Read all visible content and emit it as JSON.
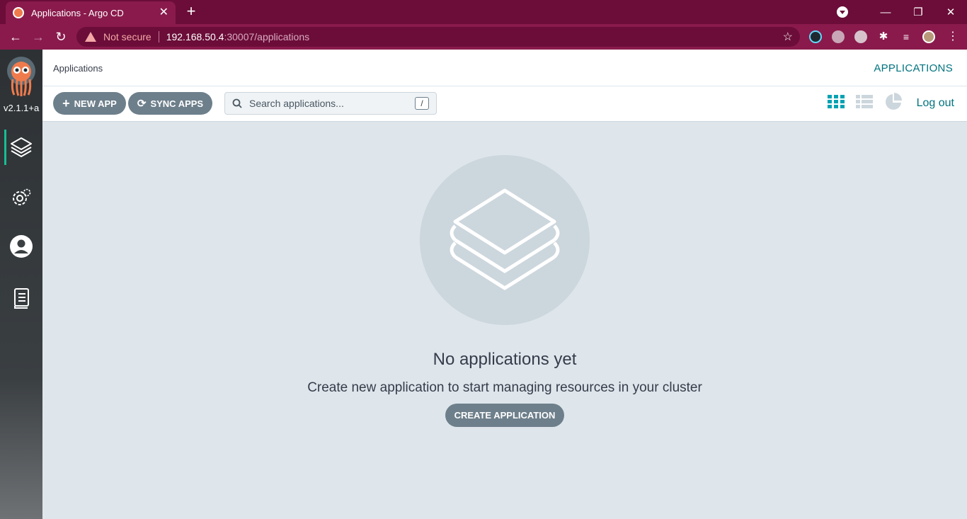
{
  "browser": {
    "tab_title": "Applications - Argo CD",
    "tab_close": "✕",
    "new_tab": "+",
    "security_label": "Not secure",
    "url_host": "192.168.50.4",
    "url_path": ":30007/applications",
    "window_minimize": "—",
    "window_restore": "❐",
    "window_close": "✕"
  },
  "sidebar": {
    "version": "v2.1.1+a",
    "items": [
      {
        "name": "applications",
        "icon": "layers-icon",
        "active": true
      },
      {
        "name": "settings",
        "icon": "gear-icon",
        "active": false
      },
      {
        "name": "user-info",
        "icon": "user-icon",
        "active": false
      },
      {
        "name": "documentation",
        "icon": "docs-icon",
        "active": false
      }
    ]
  },
  "header": {
    "breadcrumb": "Applications",
    "title": "APPLICATIONS"
  },
  "toolbar": {
    "new_app_label": "NEW APP",
    "sync_apps_label": "SYNC APPS",
    "search_placeholder": "Search applications...",
    "search_shortcut": "/",
    "logout_label": "Log out",
    "views": [
      "tiles-view",
      "list-view",
      "summary-view"
    ]
  },
  "empty_state": {
    "title": "No applications yet",
    "description": "Create new application to start managing resources in your cluster",
    "create_label": "CREATE APPLICATION"
  },
  "colors": {
    "chrome": "#6b0d38",
    "accent": "#00747f",
    "tile_active": "#00a2b3",
    "button": "#6d7f8b",
    "background": "#dee6eb"
  }
}
